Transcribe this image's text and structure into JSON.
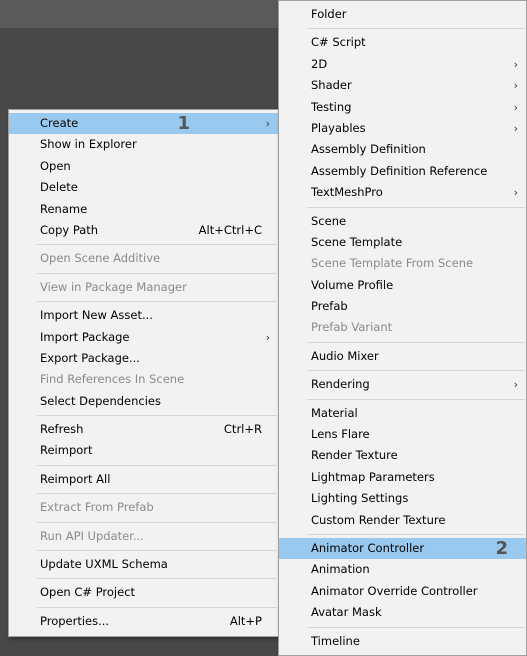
{
  "left_menu": {
    "items": [
      {
        "label": "Create",
        "submenu": true,
        "highlight": true,
        "badge": "1"
      },
      {
        "label": "Show in Explorer"
      },
      {
        "label": "Open"
      },
      {
        "label": "Delete"
      },
      {
        "label": "Rename"
      },
      {
        "label": "Copy Path",
        "shortcut": "Alt+Ctrl+C"
      },
      {
        "sep": true
      },
      {
        "label": "Open Scene Additive",
        "disabled": true
      },
      {
        "sep": true
      },
      {
        "label": "View in Package Manager",
        "disabled": true
      },
      {
        "sep": true
      },
      {
        "label": "Import New Asset..."
      },
      {
        "label": "Import Package",
        "submenu": true
      },
      {
        "label": "Export Package..."
      },
      {
        "label": "Find References In Scene",
        "disabled": true
      },
      {
        "label": "Select Dependencies"
      },
      {
        "sep": true
      },
      {
        "label": "Refresh",
        "shortcut": "Ctrl+R"
      },
      {
        "label": "Reimport"
      },
      {
        "sep": true
      },
      {
        "label": "Reimport All"
      },
      {
        "sep": true
      },
      {
        "label": "Extract From Prefab",
        "disabled": true
      },
      {
        "sep": true
      },
      {
        "label": "Run API Updater...",
        "disabled": true
      },
      {
        "sep": true
      },
      {
        "label": "Update UXML Schema"
      },
      {
        "sep": true
      },
      {
        "label": "Open C# Project"
      },
      {
        "sep": true
      },
      {
        "label": "Properties...",
        "shortcut": "Alt+P"
      }
    ]
  },
  "right_menu": {
    "items": [
      {
        "label": "Folder"
      },
      {
        "sep": true
      },
      {
        "label": "C# Script"
      },
      {
        "label": "2D",
        "submenu": true
      },
      {
        "label": "Shader",
        "submenu": true
      },
      {
        "label": "Testing",
        "submenu": true
      },
      {
        "label": "Playables",
        "submenu": true
      },
      {
        "label": "Assembly Definition"
      },
      {
        "label": "Assembly Definition Reference"
      },
      {
        "label": "TextMeshPro",
        "submenu": true
      },
      {
        "sep": true
      },
      {
        "label": "Scene"
      },
      {
        "label": "Scene Template"
      },
      {
        "label": "Scene Template From Scene",
        "disabled": true
      },
      {
        "label": "Volume Profile"
      },
      {
        "label": "Prefab"
      },
      {
        "label": "Prefab Variant",
        "disabled": true
      },
      {
        "sep": true
      },
      {
        "label": "Audio Mixer"
      },
      {
        "sep": true
      },
      {
        "label": "Rendering",
        "submenu": true
      },
      {
        "sep": true
      },
      {
        "label": "Material"
      },
      {
        "label": "Lens Flare"
      },
      {
        "label": "Render Texture"
      },
      {
        "label": "Lightmap Parameters"
      },
      {
        "label": "Lighting Settings"
      },
      {
        "label": "Custom Render Texture"
      },
      {
        "sep": true
      },
      {
        "label": "Animator Controller",
        "highlight": true,
        "badge": "2"
      },
      {
        "label": "Animation"
      },
      {
        "label": "Animator Override Controller"
      },
      {
        "label": "Avatar Mask"
      },
      {
        "sep": true
      },
      {
        "label": "Timeline"
      }
    ]
  },
  "icons": {
    "submenu_arrow": "›"
  }
}
